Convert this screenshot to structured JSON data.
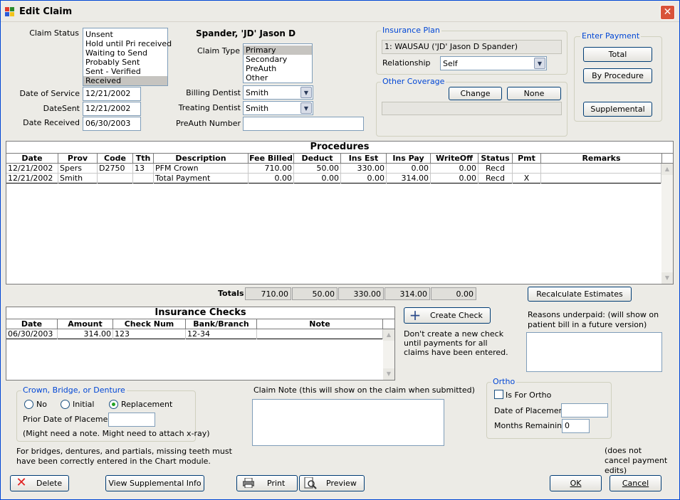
{
  "window": {
    "title": "Edit Claim",
    "close": "✕"
  },
  "claim_status": {
    "label": "Claim Status",
    "options": [
      "Unsent",
      "Hold until Pri received",
      "Waiting to Send",
      "Probably Sent",
      "Sent - Verified",
      "Received"
    ],
    "selected": "Received"
  },
  "dates": {
    "service_label": "Date of Service",
    "service": "12/21/2002",
    "sent_label": "DateSent",
    "sent": "12/21/2002",
    "received_label": "Date Received",
    "received": "06/30/2003"
  },
  "patient": {
    "name": "Spander, 'JD' Jason D"
  },
  "claim_type": {
    "label": "Claim Type",
    "options": [
      "Primary",
      "Secondary",
      "PreAuth",
      "Other"
    ],
    "selected": "Primary"
  },
  "billing_dentist": {
    "label": "Billing Dentist",
    "value": "Smith"
  },
  "treating_dentist": {
    "label": "Treating Dentist",
    "value": "Smith"
  },
  "preauth": {
    "label": "PreAuth Number",
    "value": ""
  },
  "insurance_plan": {
    "title": "Insurance Plan",
    "plan": "1: WAUSAU ('JD' Jason D Spander)",
    "relationship_label": "Relationship",
    "relationship": "Self"
  },
  "other_coverage": {
    "title": "Other Coverage",
    "change": "Change",
    "none": "None",
    "value": ""
  },
  "enter_payment": {
    "title": "Enter Payment",
    "total": "Total",
    "by_procedure": "By Procedure",
    "supplemental": "Supplemental"
  },
  "procedures": {
    "title": "Procedures",
    "columns": [
      "Date",
      "Prov",
      "Code",
      "Tth",
      "Description",
      "Fee Billed",
      "Deduct",
      "Ins Est",
      "Ins Pay",
      "WriteOff",
      "Status",
      "Pmt",
      "Remarks"
    ],
    "rows": [
      [
        "12/21/2002",
        "Spers",
        "D2750",
        "13",
        "PFM Crown",
        "710.00",
        "50.00",
        "330.00",
        "0.00",
        "0.00",
        "Recd",
        "",
        ""
      ],
      [
        "12/21/2002",
        "Smith",
        "",
        "",
        "Total Payment",
        "0.00",
        "0.00",
        "0.00",
        "314.00",
        "0.00",
        "Recd",
        "X",
        ""
      ]
    ]
  },
  "totals": {
    "label": "Totals",
    "fee": "710.00",
    "deduct": "50.00",
    "ins_est": "330.00",
    "ins_pay": "314.00",
    "writeoff": "0.00"
  },
  "recalculate": "Recalculate Estimates",
  "insurance_checks": {
    "title": "Insurance Checks",
    "columns": [
      "Date",
      "Amount",
      "Check Num",
      "Bank/Branch",
      "Note"
    ],
    "rows": [
      [
        "06/30/2003",
        "314.00",
        "123",
        "12-34",
        ""
      ]
    ]
  },
  "create_check": {
    "label": "Create Check",
    "note": "Don't create a new check until payments for all claims have been entered."
  },
  "reasons": {
    "label": "Reasons underpaid:  (will show on patient bill in a future version)",
    "value": ""
  },
  "crown": {
    "title": "Crown, Bridge, or Denture",
    "options": [
      "No",
      "Initial",
      "Replacement"
    ],
    "selected": "Replacement",
    "prior_label": "Prior Date of Placement",
    "prior_value": "",
    "hint": "(Might need a note. Might need to attach x-ray)"
  },
  "bridge_note": "For bridges, dentures, and partials, missing teeth must have been correctly entered in the Chart module.",
  "claim_note": {
    "label": "Claim Note (this will show on the claim when submitted)",
    "value": ""
  },
  "ortho": {
    "title": "Ortho",
    "is_for_ortho": "Is For Ortho",
    "placement_label": "Date of Placement",
    "placement_value": "",
    "months_label": "Months Remaining",
    "months_value": "0"
  },
  "cancel_note": "(does not cancel payment edits)",
  "buttons": {
    "delete": "Delete",
    "view_supplemental": "View Supplemental Info",
    "print": "Print",
    "preview": "Preview",
    "ok": "OK",
    "cancel": "Cancel"
  },
  "colors": {
    "title_blue": "#0046d5",
    "window_bg": "#ecebe6",
    "close_red": "#d9533a",
    "delete_red": "#e02020"
  }
}
